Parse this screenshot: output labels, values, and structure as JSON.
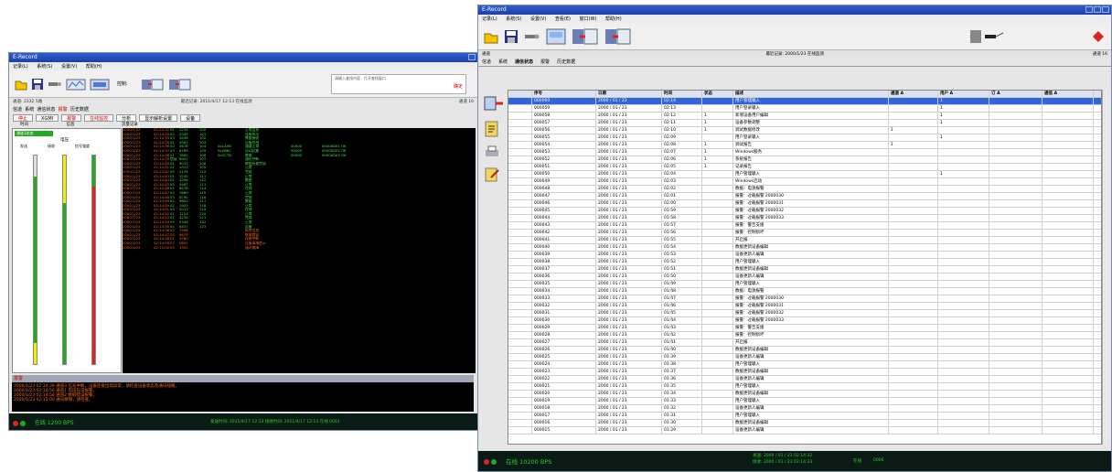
{
  "win1": {
    "title": "E-Record",
    "menu": [
      "记录(L)",
      "系统(S)",
      "设置(V)",
      "帮助(H)"
    ],
    "ctrl_label": "控制:",
    "search_text": "请输入查找内容 · 打开查找窗口",
    "search_btn": "确定",
    "info_left": "通道: 2332 5路",
    "info_center": "最近记录: 2011/4/17 12:13 在线监测",
    "info_right": "通道 16",
    "tabs": [
      "信道",
      "系统",
      "通信状态",
      "报警",
      "历史数据"
    ],
    "buttons": [
      "停止",
      "XGMI",
      "报警",
      "在线监控",
      "分析",
      "显示解析设置",
      "设备"
    ],
    "colheads": [
      "时间",
      "信息",
      "流量记录"
    ],
    "legend": "通道1状态",
    "meter_title": "电压",
    "meter_labels": [
      "发送",
      "接收",
      "信号强度"
    ],
    "log_rows": [
      [
        "2000/1/23",
        "02:14:32",
        "01",
        "1234",
        "100",
        "",
        "正常信息",
        "",
        "",
        ""
      ],
      [
        "2000/1/23",
        "02:14:33",
        "02",
        "2345",
        "101",
        "",
        "连接成功",
        "",
        "",
        ""
      ],
      [
        "2000/1/23",
        "02:14:34",
        "03",
        "3456",
        "102",
        "",
        "数据接收",
        "",
        "",
        ""
      ],
      [
        "2000/1/23",
        "02:14:35",
        "01",
        "4567",
        "103",
        "",
        "设备在线",
        "",
        "",
        ""
      ],
      [
        "2000/1/23",
        "02:14:36",
        "02",
        "5678",
        "104",
        "0x1A5B",
        "通道正常",
        "00000",
        "00000D01 OK",
        ""
      ],
      [
        "2000/1/23",
        "02:14:37",
        "03",
        "6789",
        "105",
        "0x2B6C",
        "自动回复",
        "00000",
        "00000D02 OK",
        ""
      ],
      [
        "2000/1/23",
        "02:14:38",
        "01",
        "7890",
        "106",
        "0x3C7D",
        "数据",
        "00000",
        "00000D03 OK",
        ""
      ],
      [
        "2000/1/23",
        "02:14:39",
        "错误",
        "8901",
        "107",
        "",
        "通讯中断",
        "",
        "",
        ""
      ],
      [
        "2000/1/23",
        "02:14:40",
        "01",
        "9012",
        "108",
        "",
        "数据处理完成",
        "",
        "",
        ""
      ],
      [
        "2000/1/23",
        "02:14:41",
        "02",
        "1023",
        "109",
        "",
        "正常",
        "",
        "",
        ""
      ],
      [
        "2000/1/23",
        "02:14:42",
        "03",
        "2134",
        "110",
        "",
        "完成",
        "",
        "",
        ""
      ],
      [
        "2000/1/23",
        "02:14:43",
        "01",
        "3245",
        "111",
        "",
        "正常",
        "",
        "",
        ""
      ],
      [
        "2000/1/23",
        "02:14:44",
        "02",
        "4356",
        "112",
        "",
        "数据",
        "",
        "",
        ""
      ],
      [
        "2000/1/23",
        "02:14:45",
        "03",
        "5467",
        "113",
        "",
        "正常",
        "",
        "",
        ""
      ],
      [
        "2000/1/23",
        "02:14:46",
        "01",
        "6578",
        "114",
        "",
        "在线",
        "",
        "",
        ""
      ],
      [
        "2000/1/23",
        "02:14:47",
        "02",
        "7689",
        "115",
        "",
        "正常",
        "",
        "",
        ""
      ],
      [
        "2000/1/23",
        "02:14:48",
        "03",
        "8790",
        "116",
        "",
        "完成",
        "",
        "",
        ""
      ],
      [
        "2000/1/23",
        "02:14:49",
        "01",
        "9801",
        "117",
        "",
        "数据",
        "",
        "",
        ""
      ],
      [
        "2000/1/23",
        "02:14:50",
        "02",
        "1902",
        "118",
        "",
        "正常",
        "",
        "",
        ""
      ],
      [
        "2000/1/23",
        "02:14:51",
        "03",
        "2013",
        "119",
        "",
        "在线",
        "",
        "",
        ""
      ],
      [
        "2000/1/23",
        "02:14:52",
        "01",
        "3124",
        "120",
        "",
        "正常",
        "",
        "",
        ""
      ],
      [
        "2000/1/23",
        "02:14:53",
        "02",
        "4235",
        "121",
        "",
        "完成",
        "",
        "",
        ""
      ],
      [
        "2000/1/23",
        "02:14:54",
        "03",
        "5346",
        "122",
        "",
        "正常",
        "",
        "",
        ""
      ],
      [
        "2000/1/23",
        "02:14:55",
        "01",
        "6457",
        "123",
        "",
        "设备",
        "",
        "",
        ""
      ],
      [
        "2000/1/23",
        "02:14:56",
        "02",
        "7568",
        "",
        "",
        "报警信息",
        "",
        "",
        ""
      ],
      [
        "2000/1/23",
        "02:14:57",
        "03",
        "8679",
        "",
        "",
        "数据错误",
        "",
        "",
        ""
      ],
      [
        "2000/1/23",
        "02:14:58",
        "01",
        "9780",
        "",
        "",
        "连接中断",
        "",
        "",
        ""
      ],
      [
        "2000/1/23",
        "02:14:59",
        "02",
        "0891",
        "",
        "",
        "设备离线提示",
        "",
        "",
        ""
      ],
      [
        "2000/1/23",
        "02:15:00",
        "03",
        "1902",
        "",
        "",
        "通讯故障",
        "",
        "",
        ""
      ]
    ],
    "alarm_title": "报警",
    "alarm_lines": [
      "2000/1/23 02:14:39 通道3 信号中断，设备连接出现异常，请检查设备状态及通讯线路。",
      "2000/1/23 02:14:56 通道1 电压异常报警。",
      "2000/1/23 02:14:58 通道2 数据错误报警。",
      "2000/1/23 02:15:00 通讯故障，请检查。"
    ],
    "status_text": "在线 1200 BPS",
    "status_info": "发送时间: 2011/4/17 12:13   接收时间: 2011/4/17 12:13   在线 0001",
    "bar_levels": {
      "send": 0.9,
      "recv": 0.95,
      "signal": 0.85
    }
  },
  "win2": {
    "title": "E-Record",
    "menu": [
      "记录(L)",
      "系统(S)",
      "设置(V)",
      "查看(E)",
      "窗口(W)",
      "帮助(H)"
    ],
    "strip_left": "通道",
    "strip_center": "最近记录: 2000/1/23 在线监测",
    "strip_right": "通道 16",
    "tabs": [
      "信道",
      "系统",
      "通信状态",
      "报警",
      "历史数据"
    ],
    "headers": [
      "",
      "序号",
      "日期",
      "时间",
      "状态",
      "描述",
      "通道 A",
      "用户 A",
      "订 A",
      "通信 A"
    ],
    "rows": [
      [
        "000060",
        "2000 / 01 / 23",
        "02:14",
        "",
        "用户管理输入",
        "",
        "1",
        "",
        ""
      ],
      [
        "000059",
        "2000 / 01 / 23",
        "02:13",
        "",
        "用户登录输入",
        "",
        "1",
        "",
        ""
      ],
      [
        "000058",
        "2000 / 01 / 23",
        "02:12",
        "1",
        "新增设备用户编辑",
        "",
        "1",
        "",
        ""
      ],
      [
        "000057",
        "2000 / 01 / 23",
        "02:11",
        "1",
        "设备参数调整",
        "",
        "1",
        "",
        ""
      ],
      [
        "000056",
        "2000 / 01 / 23",
        "02:10",
        "1",
        "调试数据修改",
        "1",
        "",
        "",
        ""
      ],
      [
        "000055",
        "2000 / 01 / 23",
        "02:09",
        "",
        "用户登录输入",
        "",
        "1",
        "",
        ""
      ],
      [
        "000054",
        "2000 / 01 / 23",
        "02:08",
        "1",
        "调试报告",
        "1",
        "",
        "",
        ""
      ],
      [
        "000053",
        "2000 / 01 / 23",
        "02:07",
        "1",
        "Windows服务",
        "",
        "",
        "",
        ""
      ],
      [
        "000052",
        "2000 / 01 / 23",
        "02:06",
        "1",
        "系统报告",
        "",
        "",
        "",
        ""
      ],
      [
        "000051",
        "2000 / 01 / 23",
        "02:05",
        "1",
        "记录报告",
        "",
        "",
        "",
        ""
      ],
      [
        "000050",
        "2000 / 01 / 23",
        "02:04",
        "",
        "用户管理输入",
        "",
        "1",
        "",
        ""
      ],
      [
        "000049",
        "2000 / 01 / 23",
        "02:03",
        "",
        "Windows启动",
        "",
        "",
        "",
        ""
      ],
      [
        "000048",
        "2000 / 01 / 23",
        "02:02",
        "",
        "数据：电源报警",
        "",
        "",
        "",
        ""
      ],
      [
        "000047",
        "2000 / 01 / 23",
        "02:01",
        "",
        "报警：过载报警  2000030",
        "",
        "",
        "",
        ""
      ],
      [
        "000046",
        "2000 / 01 / 23",
        "02:00",
        "",
        "报警：过载报警  2000031",
        "",
        "",
        "",
        ""
      ],
      [
        "000045",
        "2000 / 01 / 23",
        "01:59",
        "",
        "报警：过载报警  2000032",
        "",
        "",
        "",
        ""
      ],
      [
        "000044",
        "2000 / 01 / 23",
        "01:58",
        "",
        "报警：过载报警  2000033",
        "",
        "",
        "",
        ""
      ],
      [
        "000043",
        "2000 / 01 / 23",
        "01:57",
        "",
        "报警：警告支援",
        "",
        "",
        "",
        ""
      ],
      [
        "000042",
        "2000 / 01 / 23",
        "01:56",
        "",
        "报警：控制损坏",
        "",
        "",
        "",
        ""
      ],
      [
        "000041",
        "2000 / 01 / 23",
        "01:55",
        "",
        "开启报",
        "",
        "",
        "",
        ""
      ],
      [
        "000040",
        "2000 / 01 / 23",
        "01:54",
        "",
        "数据更新设备编辑",
        "",
        "",
        "",
        ""
      ],
      [
        "000039",
        "2000 / 01 / 23",
        "01:53",
        "",
        "设备更新人编辑",
        "",
        "",
        "",
        ""
      ],
      [
        "000038",
        "2000 / 01 / 23",
        "01:52",
        "",
        "用户管理输入",
        "",
        "",
        "",
        ""
      ],
      [
        "000037",
        "2000 / 01 / 23",
        "01:51",
        "",
        "数据更新设备编辑",
        "",
        "",
        "",
        ""
      ],
      [
        "000036",
        "2000 / 01 / 23",
        "01:50",
        "",
        "设备更新人编辑",
        "",
        "",
        "",
        ""
      ],
      [
        "000035",
        "2000 / 01 / 23",
        "01:49",
        "",
        "用户管理输入",
        "",
        "",
        "",
        ""
      ],
      [
        "000034",
        "2000 / 01 / 23",
        "01:48",
        "",
        "数据：电源报警",
        "",
        "",
        "",
        ""
      ],
      [
        "000033",
        "2000 / 01 / 23",
        "01:47",
        "",
        "报警：过载报警  2000030",
        "",
        "",
        "",
        ""
      ],
      [
        "000032",
        "2000 / 01 / 23",
        "01:46",
        "",
        "报警：过载报警  2000031",
        "",
        "",
        "",
        ""
      ],
      [
        "000031",
        "2000 / 01 / 23",
        "01:45",
        "",
        "报警：过载报警  2000032",
        "",
        "",
        "",
        ""
      ],
      [
        "000030",
        "2000 / 01 / 23",
        "01:44",
        "",
        "报警：过载报警  2000033",
        "",
        "",
        "",
        ""
      ],
      [
        "000029",
        "2000 / 01 / 23",
        "01:43",
        "",
        "报警：警告支援",
        "",
        "",
        "",
        ""
      ],
      [
        "000028",
        "2000 / 01 / 23",
        "01:42",
        "",
        "报警：控制损坏",
        "",
        "",
        "",
        ""
      ],
      [
        "000027",
        "2000 / 01 / 23",
        "01:41",
        "",
        "开启报",
        "",
        "",
        "",
        ""
      ],
      [
        "000026",
        "2000 / 01 / 23",
        "01:40",
        "",
        "数据更新设备编辑",
        "",
        "",
        "",
        ""
      ],
      [
        "000025",
        "2000 / 01 / 23",
        "01:39",
        "",
        "设备更新人编辑",
        "",
        "",
        "",
        ""
      ],
      [
        "000024",
        "2000 / 01 / 23",
        "01:38",
        "",
        "用户管理输入",
        "",
        "",
        "",
        ""
      ],
      [
        "000023",
        "2000 / 01 / 23",
        "01:37",
        "",
        "数据更新设备编辑",
        "",
        "",
        "",
        ""
      ],
      [
        "000022",
        "2000 / 01 / 23",
        "01:36",
        "",
        "设备更新人编辑",
        "",
        "",
        "",
        ""
      ],
      [
        "000021",
        "2000 / 01 / 23",
        "01:35",
        "",
        "用户管理输入",
        "",
        "",
        "",
        ""
      ],
      [
        "000020",
        "2000 / 01 / 23",
        "01:34",
        "",
        "数据更新设备编辑",
        "",
        "",
        "",
        ""
      ],
      [
        "000019",
        "2000 / 01 / 23",
        "01:33",
        "",
        "用户管理输入",
        "",
        "",
        "",
        ""
      ],
      [
        "000018",
        "2000 / 01 / 23",
        "01:32",
        "",
        "设备更新人编辑",
        "",
        "",
        "",
        ""
      ],
      [
        "000017",
        "2000 / 01 / 23",
        "01:31",
        "",
        "用户管理输入",
        "",
        "",
        "",
        ""
      ],
      [
        "000016",
        "2000 / 01 / 23",
        "01:30",
        "",
        "数据更新设备编辑",
        "",
        "",
        "",
        ""
      ],
      [
        "000015",
        "2000 / 01 / 23",
        "01:29",
        "",
        "设备更新人编辑",
        "",
        "",
        "",
        ""
      ]
    ],
    "status_text": "在线 10200 BPS",
    "status_info1": "发送: 2000 / 01 / 23   02:14:32",
    "status_info2": "接收: 2000 / 01 / 23   02:14:33",
    "status_online": "在线",
    "status_count": "0006"
  },
  "colors": {
    "accent": "#2f66d9",
    "status_bg": "#0a1a14",
    "status_green": "#2cd32c",
    "log_orange": "#f26a20",
    "log_green": "#4fe04f"
  }
}
